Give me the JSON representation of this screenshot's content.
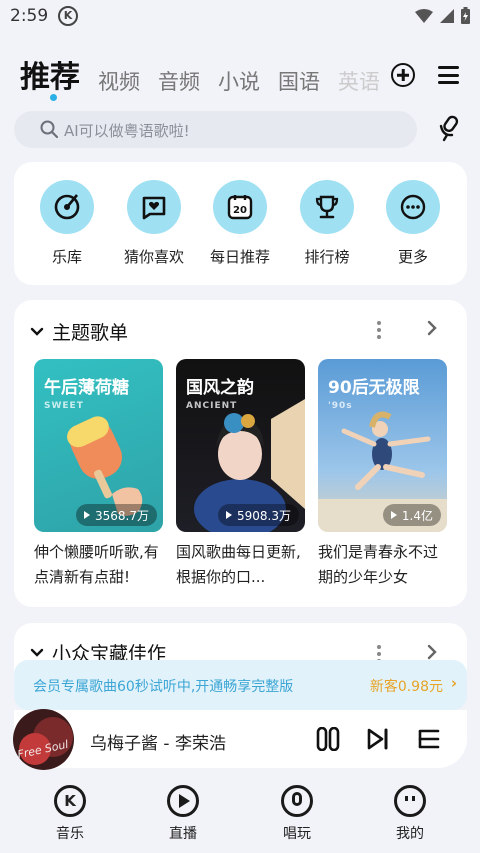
{
  "status": {
    "time": "2:59",
    "app_badge": "K"
  },
  "tabs": [
    {
      "label": "推荐",
      "active": true
    },
    {
      "label": "视频"
    },
    {
      "label": "音频"
    },
    {
      "label": "小说"
    },
    {
      "label": "国语"
    },
    {
      "label": "英语"
    }
  ],
  "search": {
    "placeholder": "AI可以做粤语歌啦!"
  },
  "quick": [
    {
      "label": "乐库",
      "icon": "vinyl-icon"
    },
    {
      "label": "猜你喜欢",
      "icon": "heart-box-icon"
    },
    {
      "label": "每日推荐",
      "icon": "calendar-icon",
      "day": "20"
    },
    {
      "label": "排行榜",
      "icon": "trophy-icon"
    },
    {
      "label": "更多",
      "icon": "more-icon"
    }
  ],
  "theme": {
    "title": "主题歌单",
    "items": [
      {
        "title": "午后薄荷糖",
        "sub": "SWEET",
        "plays": "3568.7万",
        "desc": "伸个懒腰听听歌,有点清新有点甜!"
      },
      {
        "title": "国风之韵",
        "sub": "ANCIENT",
        "plays": "5908.3万",
        "desc": "国风歌曲每日更新,根据你的口..."
      },
      {
        "title": "90后无极限",
        "sub": "'90s",
        "plays": "1.4亿",
        "desc": "我们是青春永不过期的少年少女"
      }
    ]
  },
  "gems": {
    "title": "小众宝藏佳作"
  },
  "vip": {
    "text": "会员专属歌曲60秒试听中,开通畅享完整版",
    "price": "新客0.98元",
    "arrow": "›"
  },
  "player": {
    "song": "乌梅子酱 - 李荣浩",
    "cover_text": "Free Soul"
  },
  "nav": [
    {
      "label": "音乐",
      "active": true
    },
    {
      "label": "直播"
    },
    {
      "label": "唱玩"
    },
    {
      "label": "我的"
    }
  ],
  "colors": {
    "accent": "#2ab0e6",
    "icon_bg": "#9fe0f3",
    "vip_text": "#3ca6d4",
    "vip_price": "#e7a427"
  }
}
